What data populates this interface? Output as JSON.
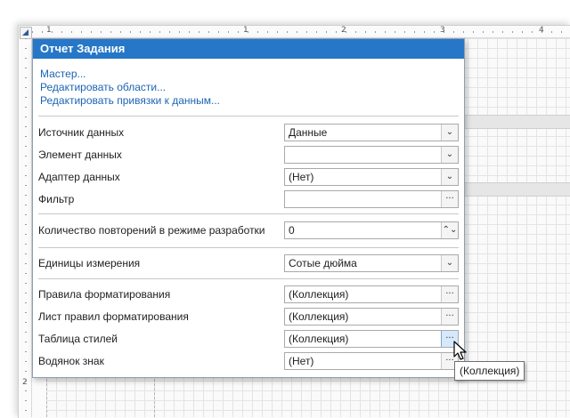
{
  "ruler": {
    "marks": [
      "1",
      "1",
      "2",
      "3",
      "4"
    ],
    "vmarks": [
      "2"
    ]
  },
  "panel": {
    "title": "Отчет Задания",
    "links": [
      "Мастер...",
      "Редактировать области...",
      "Редактировать привязки к данным..."
    ],
    "groups": {
      "data": [
        {
          "label": "Источник данных",
          "value": "Данные",
          "button": "dropdown"
        },
        {
          "label": "Элемент данных",
          "value": "",
          "button": "dropdown"
        },
        {
          "label": "Адаптер данных",
          "value": "(Нет)",
          "button": "dropdown"
        },
        {
          "label": "Фильтр",
          "value": "",
          "button": "ellipsis"
        }
      ],
      "design": [
        {
          "label": "Количество повторений в режиме разработки",
          "value": "0",
          "button": "spinner"
        }
      ],
      "units": [
        {
          "label": "Единицы измерения",
          "value": "Сотые дюйма",
          "button": "dropdown"
        }
      ],
      "formatting": [
        {
          "label": "Правила форматирования",
          "value": "(Коллекция)",
          "button": "ellipsis"
        },
        {
          "label": "Лист правил форматирования",
          "value": "(Коллекция)",
          "button": "ellipsis"
        },
        {
          "label": "Таблица стилей",
          "value": "(Коллекция)",
          "button": "ellipsis"
        },
        {
          "label": "Водянок знак",
          "value": "(Нет)",
          "button": "ellipsis"
        }
      ]
    },
    "glyphs": {
      "dropdown": "⌄",
      "ellipsis": "···",
      "spinner": "⌃⌄"
    }
  },
  "tooltip": {
    "text": "(Коллекция)"
  },
  "colors": {
    "header": "#2677c7",
    "link": "#1c64b5",
    "hover_button": "#d6e8fb"
  }
}
